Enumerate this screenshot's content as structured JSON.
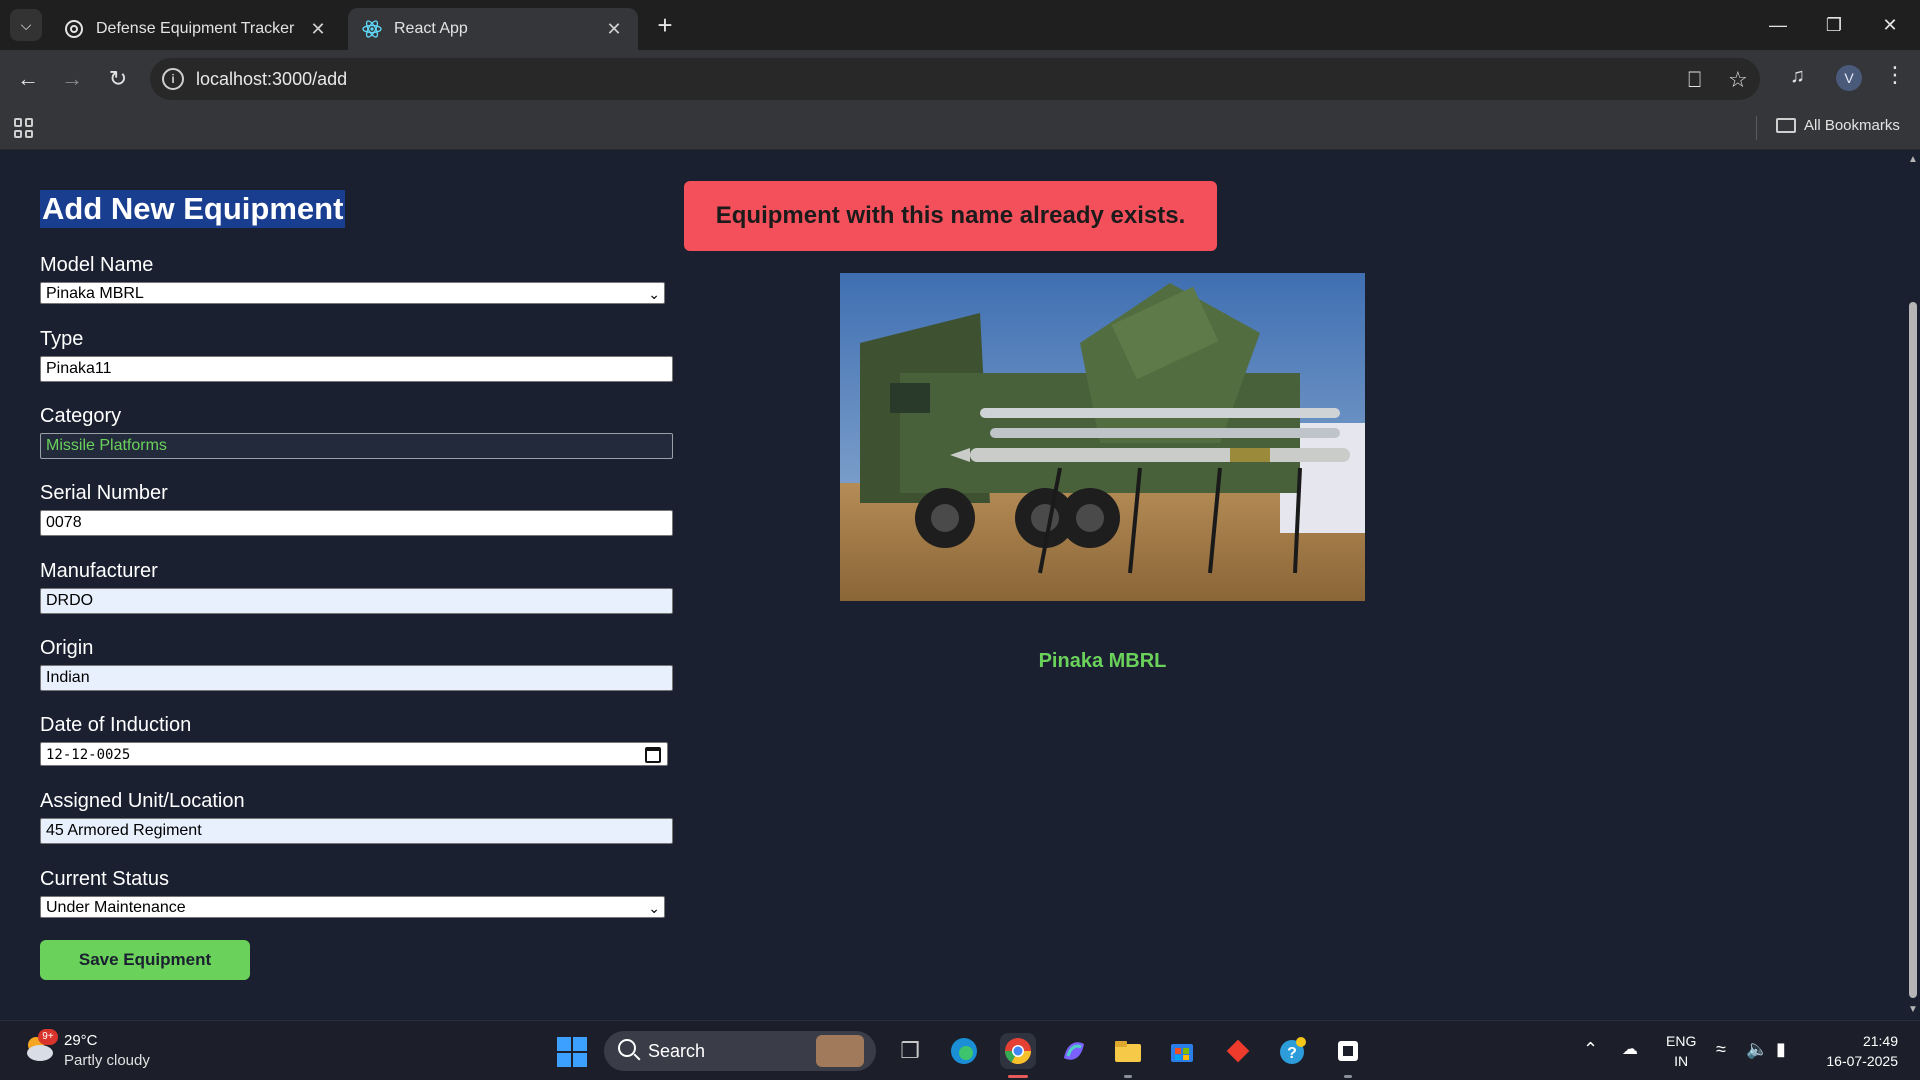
{
  "browser": {
    "tabs": [
      {
        "title": "Defense Equipment Tracker"
      },
      {
        "title": "React App"
      }
    ],
    "url": "localhost:3000/add",
    "profile_initial": "V",
    "bookmarks_label": "All Bookmarks"
  },
  "form": {
    "title": "Add New Equipment",
    "fields": {
      "model_name": {
        "label": "Model Name",
        "value": "Pinaka MBRL"
      },
      "type": {
        "label": "Type",
        "value": "Pinaka11"
      },
      "category": {
        "label": "Category",
        "value": "Missile Platforms"
      },
      "serial": {
        "label": "Serial Number",
        "value": "0078"
      },
      "manufacturer": {
        "label": "Manufacturer",
        "value": "DRDO"
      },
      "origin": {
        "label": "Origin",
        "value": "Indian"
      },
      "date": {
        "label": "Date of Induction",
        "value": "12-12-0025"
      },
      "unit": {
        "label": "Assigned Unit/Location",
        "value": "45 Armored Regiment"
      },
      "status": {
        "label": "Current Status",
        "value": "Under Maintenance"
      }
    },
    "save_label": "Save Equipment"
  },
  "error_message": "Equipment with this name already exists.",
  "preview": {
    "caption": "Pinaka MBRL"
  },
  "taskbar": {
    "weather": {
      "temp": "29°C",
      "desc": "Partly cloudy",
      "badge": "9+"
    },
    "search_label": "Search",
    "lang": {
      "line1": "ENG",
      "line2": "IN"
    },
    "clock": {
      "time": "21:49",
      "date": "16-07-2025"
    }
  },
  "colors": {
    "page_bg": "#1b2030",
    "accent_green": "#6ad15a",
    "error_red": "#f4505b",
    "title_highlight": "#1a3e8f"
  }
}
